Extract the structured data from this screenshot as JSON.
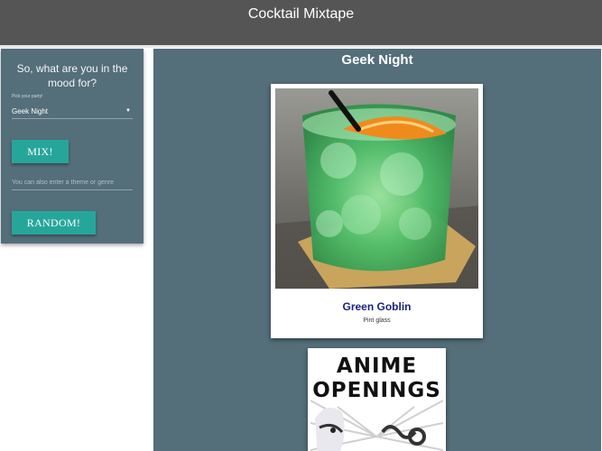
{
  "header": {
    "title": "Cocktail Mixtape"
  },
  "sidebar": {
    "prompt": "So, what are you in the mood for?",
    "select_label": "Pick your party!",
    "select_value": "Geek Night",
    "mix_button": "MIX!",
    "theme_placeholder": "You can also enter a theme or genre",
    "random_button": "RANDOM!"
  },
  "main": {
    "title": "Geek Night",
    "cards": [
      {
        "name": "Green Goblin",
        "glass": "Pint glass"
      },
      {
        "image_text_line1": "ANIME",
        "image_text_line2": "OPENINGS"
      }
    ]
  },
  "colors": {
    "header_bg": "#555555",
    "panel_bg": "#546e7a",
    "button_bg": "#26a69a",
    "drink_title": "#1a237e"
  }
}
